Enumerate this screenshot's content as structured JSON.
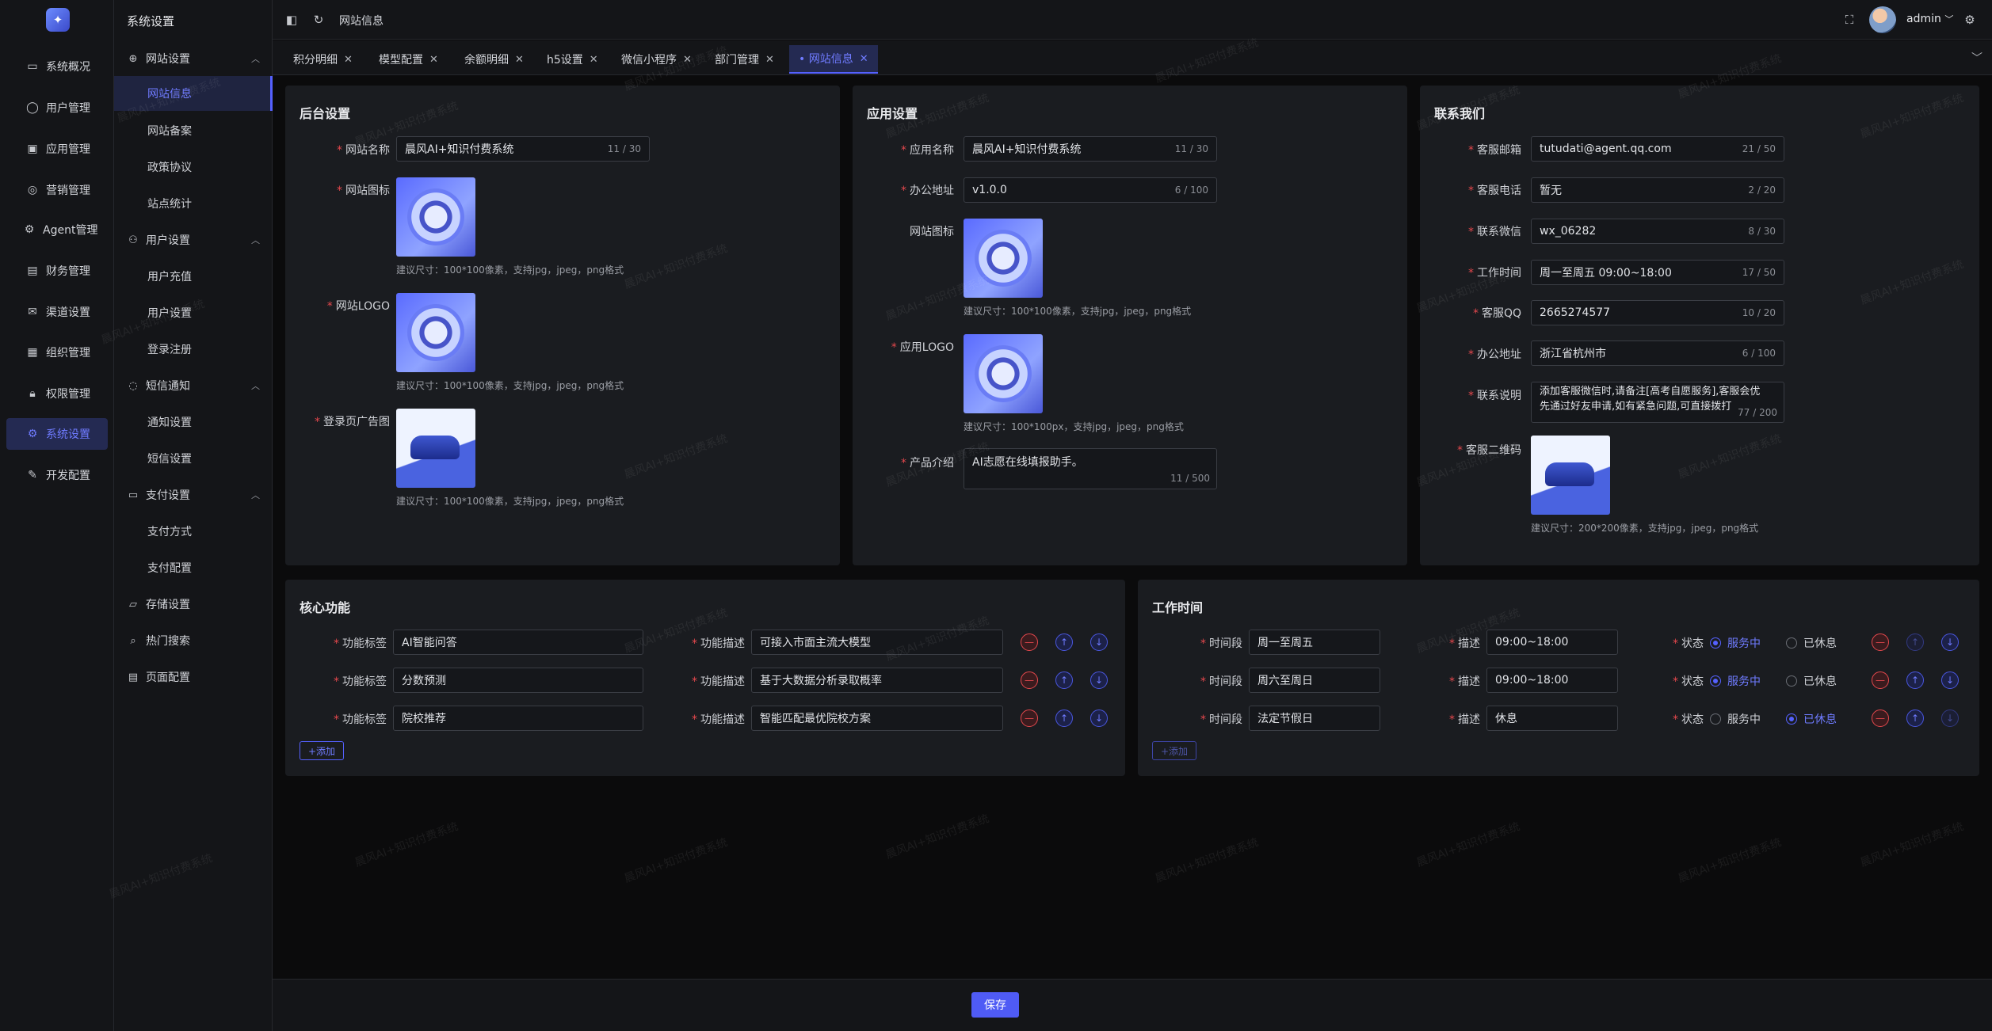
{
  "rail": {
    "items": [
      {
        "label": "系统概况",
        "icon": "monitor-icon"
      },
      {
        "label": "用户管理",
        "icon": "user-icon"
      },
      {
        "label": "应用管理",
        "icon": "app-icon"
      },
      {
        "label": "营销管理",
        "icon": "marketing-icon"
      },
      {
        "label": "Agent管理",
        "icon": "agent-icon"
      },
      {
        "label": "财务管理",
        "icon": "chart-icon"
      },
      {
        "label": "渠道设置",
        "icon": "mail-icon"
      },
      {
        "label": "组织管理",
        "icon": "org-icon"
      },
      {
        "label": "权限管理",
        "icon": "lock-icon"
      },
      {
        "label": "系统设置",
        "icon": "gear-icon"
      },
      {
        "label": "开发配置",
        "icon": "edit-icon"
      }
    ]
  },
  "submenu": {
    "title": "系统设置",
    "groups": {
      "site": "网站设置",
      "user": "用户设置",
      "sms": "短信通知",
      "pay": "支付设置",
      "storage": "存储设置",
      "search": "热门搜索",
      "page": "页面配置"
    },
    "items": {
      "site_info": "网站信息",
      "site_record": "网站备案",
      "policy": "政策协议",
      "stats": "站点统计",
      "recharge": "用户充值",
      "user_settings": "用户设置",
      "login": "登录注册",
      "notify": "通知设置",
      "sms_settings": "短信设置",
      "pay_method": "支付方式",
      "pay_config": "支付配置"
    }
  },
  "header": {
    "breadcrumb": "网站信息",
    "username": "admin"
  },
  "tabs": [
    {
      "label": "积分明细",
      "active": false
    },
    {
      "label": "模型配置",
      "active": false
    },
    {
      "label": "余额明细",
      "active": false
    },
    {
      "label": "h5设置",
      "active": false
    },
    {
      "label": "微信小程序",
      "active": false
    },
    {
      "label": "部门管理",
      "active": false
    },
    {
      "label": "• 网站信息",
      "active": true
    }
  ],
  "backend": {
    "title": "后台设置",
    "site_name_label": "网站名称",
    "site_name": "晨风AI+知识付费系统",
    "site_name_count": "11 / 30",
    "site_icon_label": "网站图标",
    "site_icon_hint": "建议尺寸：100*100像素，支持jpg，jpeg，png格式",
    "site_logo_label": "网站LOGO",
    "site_logo_hint": "建议尺寸：100*100像素，支持jpg，jpeg，png格式",
    "login_ad_label": "登录页广告图",
    "login_ad_hint": "建议尺寸：100*100像素，支持jpg，jpeg，png格式"
  },
  "app": {
    "title": "应用设置",
    "app_name_label": "应用名称",
    "app_name": "晨风AI+知识付费系统",
    "app_name_count": "11 / 30",
    "office_label": "办公地址",
    "office": "v1.0.0",
    "office_count": "6 / 100",
    "icon_label": "网站图标",
    "icon_hint": "建议尺寸：100*100像素，支持jpg，jpeg，png格式",
    "logo_label": "应用LOGO",
    "logo_hint": "建议尺寸：100*100px，支持jpg，jpeg，png格式",
    "intro_label": "产品介绍",
    "intro": "AI志愿在线填报助手。",
    "intro_count": "11 / 500"
  },
  "contact": {
    "title": "联系我们",
    "email_label": "客服邮箱",
    "email": "tutudati@agent.qq.com",
    "email_count": "21 / 50",
    "phone_label": "客服电话",
    "phone": "暂无",
    "phone_count": "2 / 20",
    "wechat_label": "联系微信",
    "wechat": "wx_06282",
    "wechat_count": "8 / 30",
    "hours_label": "工作时间",
    "hours": "周一至周五 09:00~18:00",
    "hours_count": "17 / 50",
    "qq_label": "客服QQ",
    "qq": "2665274577",
    "qq_count": "10 / 20",
    "address_label": "办公地址",
    "address": "浙江省杭州市",
    "address_count": "6 / 100",
    "note_label": "联系说明",
    "note": "添加客服微信时,请备注[高考自愿服务],客服会优先通过好友申请,如有紧急问题,可直接拨打",
    "note_count": "77 / 200",
    "qr_label": "客服二维码",
    "qr_hint": "建议尺寸：200*200像素，支持jpg，jpeg，png格式"
  },
  "core": {
    "title": "核心功能",
    "tag_label": "功能标签",
    "desc_label": "功能描述",
    "rows": [
      {
        "tag": "AI智能问答",
        "desc": "可接入市面主流大模型"
      },
      {
        "tag": "分数预测",
        "desc": "基于大数据分析录取概率"
      },
      {
        "tag": "院校推荐",
        "desc": "智能匹配最优院校方案"
      }
    ],
    "add_label": "+添加"
  },
  "worktime": {
    "title": "工作时间",
    "period_label": "时间段",
    "desc_label": "描述",
    "status_label": "状态",
    "on_label": "服务中",
    "off_label": "已休息",
    "rows": [
      {
        "period": "周一至周五",
        "desc": "09:00~18:00",
        "status": "on"
      },
      {
        "period": "周六至周日",
        "desc": "09:00~18:00",
        "status": "on"
      },
      {
        "period": "法定节假日",
        "desc": "休息",
        "status": "off"
      }
    ],
    "add_label": "+添加"
  },
  "footer": {
    "save_label": "保存"
  },
  "watermark": "晨风AI+知识付费系统",
  "colors": {
    "accent": "#5561ff",
    "danger": "#e5484d",
    "bg": "#0b0b0c",
    "panel": "#1a1c20"
  }
}
